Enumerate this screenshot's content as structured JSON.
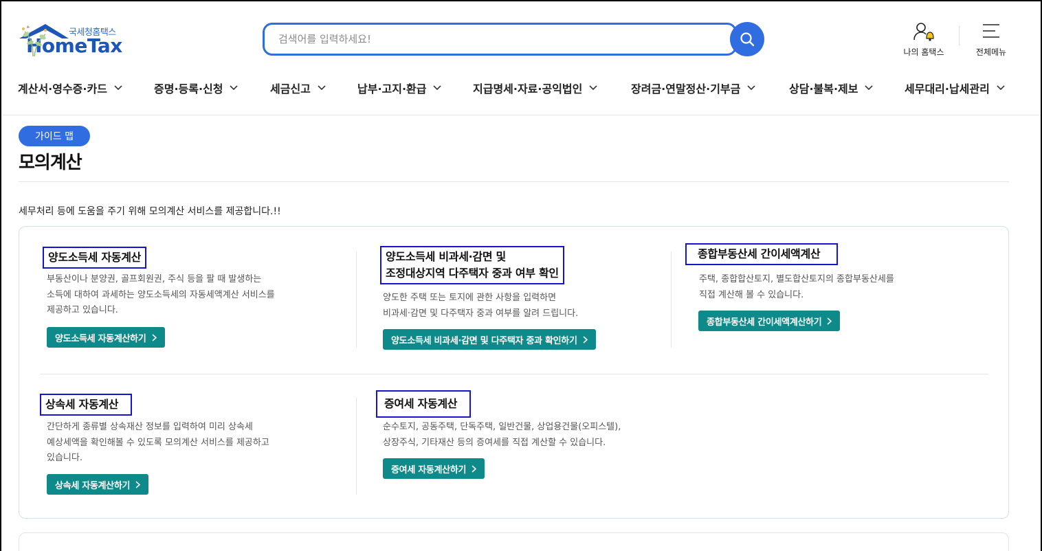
{
  "header": {
    "logo_small": "국세청홈택스",
    "logo_main": "HomeTax",
    "search_placeholder": "검색어를 입력하세요!",
    "my_hometax": "나의 홈택스",
    "all_menu": "전체메뉴"
  },
  "gnb": [
    {
      "label": "계산서·영수증·카드"
    },
    {
      "label": "증명·등록·신청"
    },
    {
      "label": "세금신고"
    },
    {
      "label": "납부·고지·환급"
    },
    {
      "label": "지급명세·자료·공익법인"
    },
    {
      "label": "장려금·연말정산·기부금"
    },
    {
      "label": "상담·불복·제보"
    },
    {
      "label": "세무대리·납세관리"
    }
  ],
  "page": {
    "guide_map": "가이드 맵",
    "title": "모의계산",
    "intro": "세무처리 등에 도움을 주기 위해 모의계산 서비스를 제공합니다.!!"
  },
  "cards": [
    {
      "title_lines": [
        "양도소득세 자동계산"
      ],
      "desc_lines": [
        "부동산이나 분양권, 골프회원권, 주식 등을 팔 때 발생하는",
        "소득에 대하여 과세하는 양도소득세의 자동세액계산 서비스를",
        "제공하고 있습니다."
      ],
      "button": "양도소득세 자동계산하기"
    },
    {
      "title_lines": [
        "양도소득세 비과세·감면 및",
        "조정대상지역 다주택자 중과 여부 확인"
      ],
      "desc_lines": [
        "양도한 주택 또는 토지에 관한 사항을 입력하면",
        "비과세·감면 및 다주택자 중과 여부를 알려 드립니다."
      ],
      "button": "양도소득세 비과세·감면 및 다주택자 중과 확인하기"
    },
    {
      "title_lines": [
        "종합부동산세 간이세액계산"
      ],
      "desc_lines": [
        "주택, 종합합산토지, 별도합산토지의 종합부동산세를",
        "직접 계산해 볼 수 있습니다."
      ],
      "button": "종합부동산세 간이세액계산하기"
    },
    {
      "title_lines": [
        "상속세 자동계산"
      ],
      "desc_lines": [
        "간단하게 종류별 상속재산 정보를 입력하여 미리 상속세",
        "예상세액을 확인해볼 수 있도록 모의계산 서비스를 제공하고",
        "있습니다."
      ],
      "button": "상속세 자동계산하기"
    },
    {
      "title_lines": [
        "증여세 자동계산"
      ],
      "desc_lines": [
        "순수토지, 공동주택, 단독주택, 일반건물, 상업용건물(오피스텔),",
        "상장주식, 기타재산 등의 증여세를 직접 계산할 수 있습니다."
      ],
      "button": "증여세 자동계산하기"
    }
  ],
  "colors": {
    "brand_blue": "#2f6de0",
    "button_teal": "#0f8a8a",
    "highlight_box": "#1414c8"
  }
}
